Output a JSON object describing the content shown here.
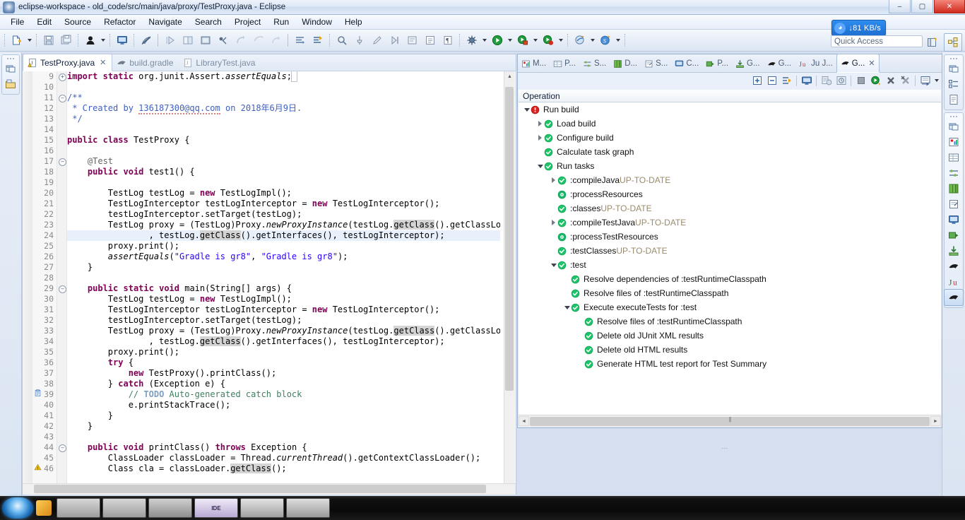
{
  "window": {
    "title": "eclipse-workspace - old_code/src/main/java/proxy/TestProxy.java - Eclipse",
    "minimize": "–",
    "maximize": "▢",
    "close": "✕"
  },
  "menu": {
    "items": [
      {
        "label": "File"
      },
      {
        "label": "Edit"
      },
      {
        "label": "Source"
      },
      {
        "label": "Refactor"
      },
      {
        "label": "Navigate"
      },
      {
        "label": "Search"
      },
      {
        "label": "Project"
      },
      {
        "label": "Run"
      },
      {
        "label": "Window"
      },
      {
        "label": "Help"
      }
    ]
  },
  "toolbar": {
    "quick_access_placeholder": "Quick Access",
    "network_widget": {
      "icon": "cloud-sync-icon",
      "speed": "81 KB/s",
      "direction": "↓"
    },
    "groups": [
      {
        "name": "file-group",
        "buttons": [
          "new-wizard-icon",
          "new-dropdown-arrow",
          "save-icon",
          "save-all-icon"
        ]
      },
      {
        "name": "person-group",
        "buttons": [
          "user-icon",
          "user-dropdown-arrow"
        ]
      },
      {
        "name": "console-group",
        "buttons": [
          "open-console-icon"
        ]
      },
      {
        "name": "annotation-group",
        "buttons": [
          "toggle-mark-occurrences-icon"
        ]
      },
      {
        "name": "nav-group",
        "buttons": [
          "step-forward-icon",
          "split-editor-icon",
          "terminal-icon",
          "skip-breakpoints-icon",
          "resume-icon",
          "suspend-icon",
          "disconnect-icon"
        ]
      },
      {
        "name": "layout-group",
        "buttons": [
          "layout-icon",
          "quick-outline-icon"
        ]
      },
      {
        "name": "search-group",
        "buttons": [
          "search-icon",
          "pin-icon",
          "pencil-icon",
          "next-annotation-icon",
          "prev-annotation-icon",
          "last-edit-icon",
          "pilcrow-icon"
        ]
      },
      {
        "name": "debug-group",
        "buttons": [
          "debug-icon",
          "debug-arrow",
          "run-icon",
          "run-arrow",
          "coverage-icon",
          "coverage-arrow",
          "profile-icon",
          "profile-arrow"
        ]
      },
      {
        "name": "external-group",
        "buttons": [
          "external-tools-icon",
          "external-arrow",
          "sonar-icon",
          "sonar-arrow"
        ]
      },
      {
        "name": "perspective-group",
        "buttons": [
          "open-perspective-icon",
          "java-perspective-icon"
        ]
      }
    ]
  },
  "left_bar": {
    "icons": [
      "restore-view-icon",
      "package-explorer-icon"
    ]
  },
  "right_bar": {
    "group_one": [
      "restore-view-icon",
      "outline-view-icon",
      "task-list-icon"
    ],
    "group_two": [
      "restore-view-icon",
      "problems-view-icon",
      "properties-view-icon",
      "servers-view-icon",
      "data-source-explorer-icon",
      "snippets-view-icon",
      "console-view-icon",
      "progress-view-icon",
      "gradle-tasks-icon",
      "gradle-view-icon",
      "junit-view-icon",
      "gradle-executions-icon"
    ],
    "selected": "gradle-executions-icon"
  },
  "editor": {
    "tabs": [
      {
        "label": "TestProxy.java",
        "icon": "java-file-warning-icon",
        "active": true,
        "closable": true
      },
      {
        "label": "build.gradle",
        "icon": "gradle-file-icon",
        "active": false,
        "closable": false
      },
      {
        "label": "LibraryTest.java",
        "icon": "java-file-icon",
        "active": false,
        "closable": false
      }
    ],
    "first_visible_line": 9,
    "code_lines": [
      {
        "n": 9,
        "marker": "",
        "fold": "plus",
        "html": "<span class=\"kw\">import</span> <span class=\"kw\">static</span> org.junit.Assert.<span class=\"it\">assertEquals</span>;<span style=\"outline:1px solid #b9c0c9;\">&nbsp;</span>"
      },
      {
        "n": 10,
        "marker": "",
        "fold": "",
        "html": ""
      },
      {
        "n": 11,
        "marker": "",
        "fold": "minus",
        "html": "<span class=\"jd\">/**</span>"
      },
      {
        "n": 12,
        "marker": "",
        "fold": "",
        "html": "<span class=\"jd\"> * Created by </span><span class=\"jd sq\">136187300@qq.com</span><span class=\"jd\"> on 2018年6月9日.</span>"
      },
      {
        "n": 13,
        "marker": "",
        "fold": "",
        "html": "<span class=\"jd\"> */</span>"
      },
      {
        "n": 14,
        "marker": "",
        "fold": "",
        "html": ""
      },
      {
        "n": 15,
        "marker": "",
        "fold": "",
        "html": "<span class=\"kw\">public</span> <span class=\"kw\">class</span> TestProxy {"
      },
      {
        "n": 16,
        "marker": "",
        "fold": "",
        "html": ""
      },
      {
        "n": 17,
        "marker": "",
        "fold": "minus",
        "html": "    <span class=\"an\">@Test</span>"
      },
      {
        "n": 18,
        "marker": "",
        "fold": "",
        "html": "    <span class=\"kw\">public</span> <span class=\"kw\">void</span> test1() {"
      },
      {
        "n": 19,
        "marker": "",
        "fold": "",
        "html": ""
      },
      {
        "n": 20,
        "marker": "",
        "fold": "",
        "html": "        TestLog testLog = <span class=\"kw\">new</span> TestLogImpl();"
      },
      {
        "n": 21,
        "marker": "",
        "fold": "",
        "html": "        TestLogInterceptor testLogInterceptor = <span class=\"kw\">new</span> TestLogInterceptor();"
      },
      {
        "n": 22,
        "marker": "",
        "fold": "",
        "html": "        testLogInterceptor.setTarget(testLog);"
      },
      {
        "n": 23,
        "marker": "",
        "fold": "",
        "html": "        TestLog proxy = (TestLog)Proxy.<span class=\"it\">newProxyInstance</span>(testLog.<span class=\"hlword\">getClass</span>().getClassLoader()"
      },
      {
        "n": 24,
        "marker": "",
        "fold": "",
        "hl": true,
        "html": "                , testLog.<span class=\"hlword\">getClass</span>().getInterfaces(), testLogInterceptor);"
      },
      {
        "n": 25,
        "marker": "",
        "fold": "",
        "html": "        proxy.print();"
      },
      {
        "n": 26,
        "marker": "",
        "fold": "",
        "html": "        <span class=\"it\">assertEquals</span>(<span class=\"st\">\"Gradle is gr8\"</span>, <span class=\"st\">\"Gradle is gr8\"</span>);"
      },
      {
        "n": 27,
        "marker": "",
        "fold": "",
        "html": "    }"
      },
      {
        "n": 28,
        "marker": "",
        "fold": "",
        "html": ""
      },
      {
        "n": 29,
        "marker": "",
        "fold": "minus",
        "html": "    <span class=\"kw\">public</span> <span class=\"kw\">static</span> <span class=\"kw\">void</span> main(String[] args) {"
      },
      {
        "n": 30,
        "marker": "",
        "fold": "",
        "html": "        TestLog testLog = <span class=\"kw\">new</span> TestLogImpl();"
      },
      {
        "n": 31,
        "marker": "",
        "fold": "",
        "html": "        TestLogInterceptor testLogInterceptor = <span class=\"kw\">new</span> TestLogInterceptor();"
      },
      {
        "n": 32,
        "marker": "",
        "fold": "",
        "html": "        testLogInterceptor.setTarget(testLog);"
      },
      {
        "n": 33,
        "marker": "",
        "fold": "",
        "html": "        TestLog proxy = (TestLog)Proxy.<span class=\"it\">newProxyInstance</span>(testLog.<span class=\"hlword\">getClass</span>().getClassLoader()"
      },
      {
        "n": 34,
        "marker": "",
        "fold": "",
        "html": "                , testLog.<span class=\"hlword\">getClass</span>().getInterfaces(), testLogInterceptor);"
      },
      {
        "n": 35,
        "marker": "",
        "fold": "",
        "html": "        proxy.print();"
      },
      {
        "n": 36,
        "marker": "",
        "fold": "",
        "html": "        <span class=\"kw\">try</span> {"
      },
      {
        "n": 37,
        "marker": "",
        "fold": "",
        "html": "            <span class=\"kw\">new</span> TestProxy().printClass();"
      },
      {
        "n": 38,
        "marker": "",
        "fold": "",
        "html": "        } <span class=\"kw\">catch</span> (Exception e) {"
      },
      {
        "n": 39,
        "marker": "todo",
        "fold": "",
        "html": "            <span class=\"cm\">// </span><span class=\"task\">TODO</span><span class=\"cm\"> Auto-generated catch block</span>"
      },
      {
        "n": 40,
        "marker": "",
        "fold": "",
        "html": "            e.printStackTrace();"
      },
      {
        "n": 41,
        "marker": "",
        "fold": "",
        "html": "        }"
      },
      {
        "n": 42,
        "marker": "",
        "fold": "",
        "html": "    }"
      },
      {
        "n": 43,
        "marker": "",
        "fold": "",
        "html": ""
      },
      {
        "n": 44,
        "marker": "",
        "fold": "minus",
        "html": "    <span class=\"kw\">public</span> <span class=\"kw\">void</span> printClass() <span class=\"kw\">throws</span> Exception {"
      },
      {
        "n": 45,
        "marker": "",
        "fold": "",
        "html": "        ClassLoader classLoader = Thread.<span class=\"it\">currentThread</span>().getContextClassLoader();"
      },
      {
        "n": 46,
        "marker": "warn",
        "fold": "",
        "html": "        Class cla = classLoader.<span class=\"hlword\">getClass</span>();"
      }
    ]
  },
  "view_pane": {
    "tabs": [
      {
        "label": "M...",
        "icon": "markers-view-icon",
        "active": false
      },
      {
        "label": "P...",
        "icon": "properties-view-icon",
        "active": false
      },
      {
        "label": "S...",
        "icon": "servers-view-icon",
        "active": false
      },
      {
        "label": "D...",
        "icon": "data-source-explorer-icon",
        "active": false
      },
      {
        "label": "S...",
        "icon": "snippets-view-icon",
        "active": false
      },
      {
        "label": "C...",
        "icon": "console-view-icon",
        "active": false
      },
      {
        "label": "P...",
        "icon": "progress-view-icon",
        "active": false
      },
      {
        "label": "G...",
        "icon": "gradle-tasks-icon",
        "active": false
      },
      {
        "label": "G...",
        "icon": "gradle-view-icon",
        "active": false
      },
      {
        "label": "Ju J...",
        "icon": "junit-view-icon",
        "active": false
      },
      {
        "label": "G...",
        "icon": "gradle-executions-icon",
        "active": true,
        "closable": true
      }
    ],
    "toolbar_buttons": [
      "expand-all-icon",
      "collapse-all-icon",
      "link-with-selection-icon",
      "show-console-icon",
      "cancel-build-icon",
      "show-timing-icon",
      "stop-icon",
      "rerun-build-icon",
      "remove-icon",
      "remove-all-icon",
      "view-menu-icon",
      "view-menu-arrow"
    ],
    "column_header": "Operation",
    "tree": [
      {
        "depth": 0,
        "twist": "open",
        "status": "error",
        "label": "Run build",
        "suffix": ""
      },
      {
        "depth": 1,
        "twist": "closed",
        "status": "success",
        "label": "Load build",
        "suffix": ""
      },
      {
        "depth": 1,
        "twist": "closed",
        "status": "success",
        "label": "Configure build",
        "suffix": ""
      },
      {
        "depth": 1,
        "twist": "none",
        "status": "success",
        "label": "Calculate task graph",
        "suffix": ""
      },
      {
        "depth": 1,
        "twist": "open",
        "status": "success",
        "label": "Run tasks",
        "suffix": ""
      },
      {
        "depth": 2,
        "twist": "closed",
        "status": "success",
        "label": ":compileJava",
        "suffix": "UP-TO-DATE"
      },
      {
        "depth": 2,
        "twist": "none",
        "status": "skipped",
        "label": ":processResources",
        "suffix": ""
      },
      {
        "depth": 2,
        "twist": "none",
        "status": "success",
        "label": ":classes",
        "suffix": "UP-TO-DATE"
      },
      {
        "depth": 2,
        "twist": "closed",
        "status": "success",
        "label": ":compileTestJava",
        "suffix": "UP-TO-DATE"
      },
      {
        "depth": 2,
        "twist": "none",
        "status": "skipped",
        "label": ":processTestResources",
        "suffix": ""
      },
      {
        "depth": 2,
        "twist": "none",
        "status": "success",
        "label": ":testClasses",
        "suffix": "UP-TO-DATE"
      },
      {
        "depth": 2,
        "twist": "open",
        "status": "success",
        "label": ":test",
        "suffix": ""
      },
      {
        "depth": 3,
        "twist": "none",
        "status": "success",
        "label": "Resolve dependencies of :testRuntimeClasspath",
        "suffix": ""
      },
      {
        "depth": 3,
        "twist": "none",
        "status": "success",
        "label": "Resolve files of :testRuntimeClasspath",
        "suffix": ""
      },
      {
        "depth": 3,
        "twist": "open",
        "status": "success",
        "label": "Execute executeTests for :test",
        "suffix": ""
      },
      {
        "depth": 4,
        "twist": "none",
        "status": "success",
        "label": "Resolve files of :testRuntimeClasspath",
        "suffix": ""
      },
      {
        "depth": 4,
        "twist": "none",
        "status": "success",
        "label": "Delete old JUnit XML results",
        "suffix": ""
      },
      {
        "depth": 4,
        "twist": "none",
        "status": "success",
        "label": "Delete old HTML results",
        "suffix": ""
      },
      {
        "depth": 4,
        "twist": "none",
        "status": "success",
        "label": "Generate HTML test report for Test Summary",
        "suffix": ""
      }
    ]
  },
  "colors": {
    "success": "#1ec46a",
    "error": "#e02020",
    "skipped": "#19b86b",
    "accent": "#2f8cf0",
    "keyword": "#7f0055",
    "string": "#2a00ff",
    "comment": "#3f7f5f",
    "javadoc": "#3f5fbf",
    "uptodate": "#9a8a6a"
  },
  "taskbar": {
    "items": [
      "start-orb",
      "quick-launch-icon",
      "window-1",
      "window-2",
      "window-3",
      "window-eclipse",
      "window-4",
      "window-5"
    ]
  }
}
